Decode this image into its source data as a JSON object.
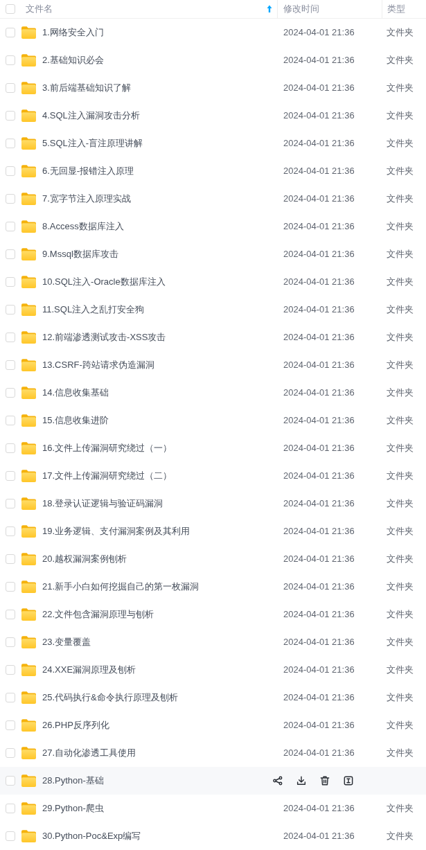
{
  "header": {
    "select_all": {
      "checked": false
    },
    "columns": [
      {
        "label": "文件名",
        "sorted": true
      },
      {
        "label": "修改时间",
        "sorted": false
      },
      {
        "label": "类型",
        "sorted": false
      }
    ]
  },
  "rows": [
    {
      "name": "1.网络安全入门",
      "modified": "2024-04-01 21:36",
      "type": "文件夹",
      "checked": false,
      "hovered": false
    },
    {
      "name": "2.基础知识必会",
      "modified": "2024-04-01 21:36",
      "type": "文件夹",
      "checked": false,
      "hovered": false
    },
    {
      "name": "3.前后端基础知识了解",
      "modified": "2024-04-01 21:36",
      "type": "文件夹",
      "checked": false,
      "hovered": false
    },
    {
      "name": "4.SQL注入漏洞攻击分析",
      "modified": "2024-04-01 21:36",
      "type": "文件夹",
      "checked": false,
      "hovered": false
    },
    {
      "name": "5.SQL注入-盲注原理讲解",
      "modified": "2024-04-01 21:36",
      "type": "文件夹",
      "checked": false,
      "hovered": false
    },
    {
      "name": "6.无回显-报错注入原理",
      "modified": "2024-04-01 21:36",
      "type": "文件夹",
      "checked": false,
      "hovered": false
    },
    {
      "name": "7.宽字节注入原理实战",
      "modified": "2024-04-01 21:36",
      "type": "文件夹",
      "checked": false,
      "hovered": false
    },
    {
      "name": "8.Access数据库注入",
      "modified": "2024-04-01 21:36",
      "type": "文件夹",
      "checked": false,
      "hovered": false
    },
    {
      "name": "9.Mssql数据库攻击",
      "modified": "2024-04-01 21:36",
      "type": "文件夹",
      "checked": false,
      "hovered": false
    },
    {
      "name": "10.SQL注入-Oracle数据库注入",
      "modified": "2024-04-01 21:36",
      "type": "文件夹",
      "checked": false,
      "hovered": false
    },
    {
      "name": "11.SQL注入之乱打安全狗",
      "modified": "2024-04-01 21:36",
      "type": "文件夹",
      "checked": false,
      "hovered": false
    },
    {
      "name": "12.前端渗透测试攻击-XSS攻击",
      "modified": "2024-04-01 21:36",
      "type": "文件夹",
      "checked": false,
      "hovered": false
    },
    {
      "name": "13.CSRF-跨站请求伪造漏洞",
      "modified": "2024-04-01 21:36",
      "type": "文件夹",
      "checked": false,
      "hovered": false
    },
    {
      "name": "14.信息收集基础",
      "modified": "2024-04-01 21:36",
      "type": "文件夹",
      "checked": false,
      "hovered": false
    },
    {
      "name": "15.信息收集进阶",
      "modified": "2024-04-01 21:36",
      "type": "文件夹",
      "checked": false,
      "hovered": false
    },
    {
      "name": "16.文件上传漏洞研究绕过（一）",
      "modified": "2024-04-01 21:36",
      "type": "文件夹",
      "checked": false,
      "hovered": false
    },
    {
      "name": "17.文件上传漏洞研究绕过（二）",
      "modified": "2024-04-01 21:36",
      "type": "文件夹",
      "checked": false,
      "hovered": false
    },
    {
      "name": "18.登录认证逻辑与验证码漏洞",
      "modified": "2024-04-01 21:36",
      "type": "文件夹",
      "checked": false,
      "hovered": false
    },
    {
      "name": "19.业务逻辑、支付漏洞案例及其利用",
      "modified": "2024-04-01 21:36",
      "type": "文件夹",
      "checked": false,
      "hovered": false
    },
    {
      "name": "20.越权漏洞案例刨析",
      "modified": "2024-04-01 21:36",
      "type": "文件夹",
      "checked": false,
      "hovered": false
    },
    {
      "name": "21.新手小白如何挖掘自己的第一枚漏洞",
      "modified": "2024-04-01 21:36",
      "type": "文件夹",
      "checked": false,
      "hovered": false
    },
    {
      "name": "22.文件包含漏洞原理与刨析",
      "modified": "2024-04-01 21:36",
      "type": "文件夹",
      "checked": false,
      "hovered": false
    },
    {
      "name": "23.变量覆盖",
      "modified": "2024-04-01 21:36",
      "type": "文件夹",
      "checked": false,
      "hovered": false
    },
    {
      "name": "24.XXE漏洞原理及刨析",
      "modified": "2024-04-01 21:36",
      "type": "文件夹",
      "checked": false,
      "hovered": false
    },
    {
      "name": "25.代码执行&命令执行原理及刨析",
      "modified": "2024-04-01 21:36",
      "type": "文件夹",
      "checked": false,
      "hovered": false
    },
    {
      "name": "26.PHP反序列化",
      "modified": "2024-04-01 21:36",
      "type": "文件夹",
      "checked": false,
      "hovered": false
    },
    {
      "name": "27.自动化渗透工具使用",
      "modified": "2024-04-01 21:36",
      "type": "文件夹",
      "checked": false,
      "hovered": false
    },
    {
      "name": "28.Python-基础",
      "checked": false,
      "hovered": true
    },
    {
      "name": "29.Python-爬虫",
      "modified": "2024-04-01 21:36",
      "type": "文件夹",
      "checked": false,
      "hovered": false
    },
    {
      "name": "30.Python-Poc&Exp编写",
      "modified": "2024-04-01 21:36",
      "type": "文件夹",
      "checked": false,
      "hovered": false
    }
  ]
}
